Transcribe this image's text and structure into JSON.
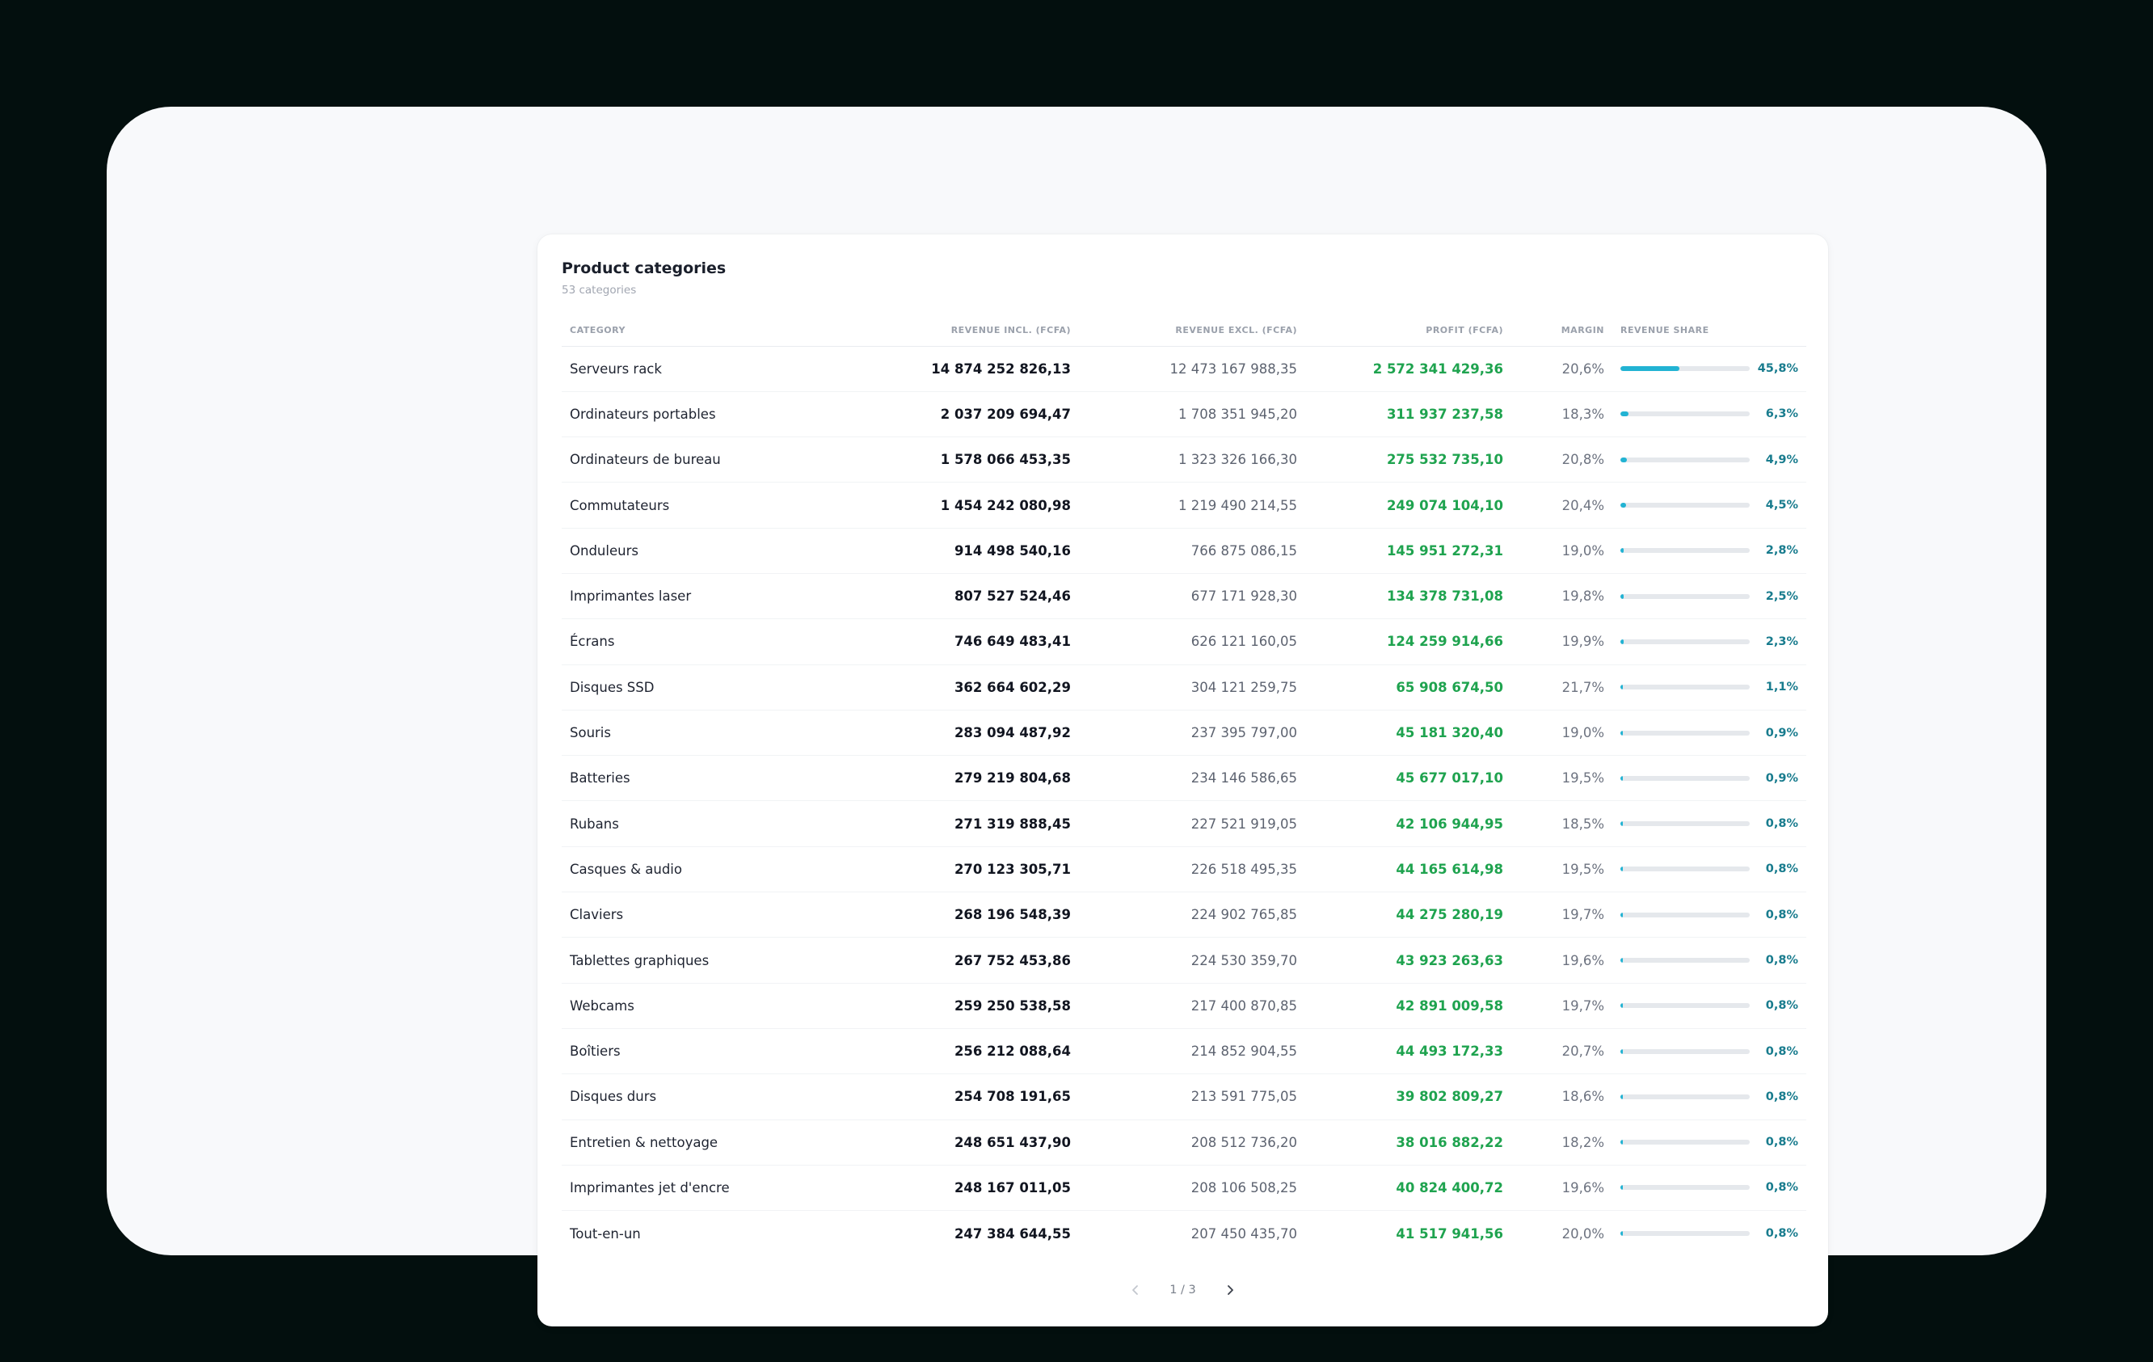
{
  "card": {
    "title": "Product categories",
    "subtitle": "53 categories"
  },
  "columns": {
    "category": "CATEGORY",
    "revenue_incl": "REVENUE INCL. (FCFA)",
    "revenue_excl": "REVENUE EXCL. (FCFA)",
    "profit": "PROFIT (FCFA)",
    "margin": "MARGIN",
    "share": "REVENUE SHARE"
  },
  "rows": [
    {
      "category": "Serveurs rack",
      "incl": "14 874 252 826,13",
      "excl": "12 473 167 988,35",
      "profit": "2 572 341 429,36",
      "margin": "20,6%",
      "share": "45,8%",
      "share_value": 45.8
    },
    {
      "category": "Ordinateurs portables",
      "incl": "2 037 209 694,47",
      "excl": "1 708 351 945,20",
      "profit": "311 937 237,58",
      "margin": "18,3%",
      "share": "6,3%",
      "share_value": 6.3
    },
    {
      "category": "Ordinateurs de bureau",
      "incl": "1 578 066 453,35",
      "excl": "1 323 326 166,30",
      "profit": "275 532 735,10",
      "margin": "20,8%",
      "share": "4,9%",
      "share_value": 4.9
    },
    {
      "category": "Commutateurs",
      "incl": "1 454 242 080,98",
      "excl": "1 219 490 214,55",
      "profit": "249 074 104,10",
      "margin": "20,4%",
      "share": "4,5%",
      "share_value": 4.5
    },
    {
      "category": "Onduleurs",
      "incl": "914 498 540,16",
      "excl": "766 875 086,15",
      "profit": "145 951 272,31",
      "margin": "19,0%",
      "share": "2,8%",
      "share_value": 2.8
    },
    {
      "category": "Imprimantes laser",
      "incl": "807 527 524,46",
      "excl": "677 171 928,30",
      "profit": "134 378 731,08",
      "margin": "19,8%",
      "share": "2,5%",
      "share_value": 2.5
    },
    {
      "category": "Écrans",
      "incl": "746 649 483,41",
      "excl": "626 121 160,05",
      "profit": "124 259 914,66",
      "margin": "19,9%",
      "share": "2,3%",
      "share_value": 2.3
    },
    {
      "category": "Disques SSD",
      "incl": "362 664 602,29",
      "excl": "304 121 259,75",
      "profit": "65 908 674,50",
      "margin": "21,7%",
      "share": "1,1%",
      "share_value": 1.1
    },
    {
      "category": "Souris",
      "incl": "283 094 487,92",
      "excl": "237 395 797,00",
      "profit": "45 181 320,40",
      "margin": "19,0%",
      "share": "0,9%",
      "share_value": 0.9
    },
    {
      "category": "Batteries",
      "incl": "279 219 804,68",
      "excl": "234 146 586,65",
      "profit": "45 677 017,10",
      "margin": "19,5%",
      "share": "0,9%",
      "share_value": 0.9
    },
    {
      "category": "Rubans",
      "incl": "271 319 888,45",
      "excl": "227 521 919,05",
      "profit": "42 106 944,95",
      "margin": "18,5%",
      "share": "0,8%",
      "share_value": 0.8
    },
    {
      "category": "Casques & audio",
      "incl": "270 123 305,71",
      "excl": "226 518 495,35",
      "profit": "44 165 614,98",
      "margin": "19,5%",
      "share": "0,8%",
      "share_value": 0.8
    },
    {
      "category": "Claviers",
      "incl": "268 196 548,39",
      "excl": "224 902 765,85",
      "profit": "44 275 280,19",
      "margin": "19,7%",
      "share": "0,8%",
      "share_value": 0.8
    },
    {
      "category": "Tablettes graphiques",
      "incl": "267 752 453,86",
      "excl": "224 530 359,70",
      "profit": "43 923 263,63",
      "margin": "19,6%",
      "share": "0,8%",
      "share_value": 0.8
    },
    {
      "category": "Webcams",
      "incl": "259 250 538,58",
      "excl": "217 400 870,85",
      "profit": "42 891 009,58",
      "margin": "19,7%",
      "share": "0,8%",
      "share_value": 0.8
    },
    {
      "category": "Boîtiers",
      "incl": "256 212 088,64",
      "excl": "214 852 904,55",
      "profit": "44 493 172,33",
      "margin": "20,7%",
      "share": "0,8%",
      "share_value": 0.8
    },
    {
      "category": "Disques durs",
      "incl": "254 708 191,65",
      "excl": "213 591 775,05",
      "profit": "39 802 809,27",
      "margin": "18,6%",
      "share": "0,8%",
      "share_value": 0.8
    },
    {
      "category": "Entretien & nettoyage",
      "incl": "248 651 437,90",
      "excl": "208 512 736,20",
      "profit": "38 016 882,22",
      "margin": "18,2%",
      "share": "0,8%",
      "share_value": 0.8
    },
    {
      "category": "Imprimantes jet d'encre",
      "incl": "248 167 011,05",
      "excl": "208 106 508,25",
      "profit": "40 824 400,72",
      "margin": "19,6%",
      "share": "0,8%",
      "share_value": 0.8
    },
    {
      "category": "Tout-en-un",
      "incl": "247 384 644,55",
      "excl": "207 450 435,70",
      "profit": "41 517 941,56",
      "margin": "20,0%",
      "share": "0,8%",
      "share_value": 0.8
    }
  ],
  "pagination": {
    "label": "1 / 3"
  },
  "icons": {
    "prev": "chevron-left-icon",
    "next": "chevron-right-icon"
  },
  "colors": {
    "bar_fill": "#22b3d3",
    "profit": "#1fa34f",
    "share_text": "#197c8e"
  }
}
